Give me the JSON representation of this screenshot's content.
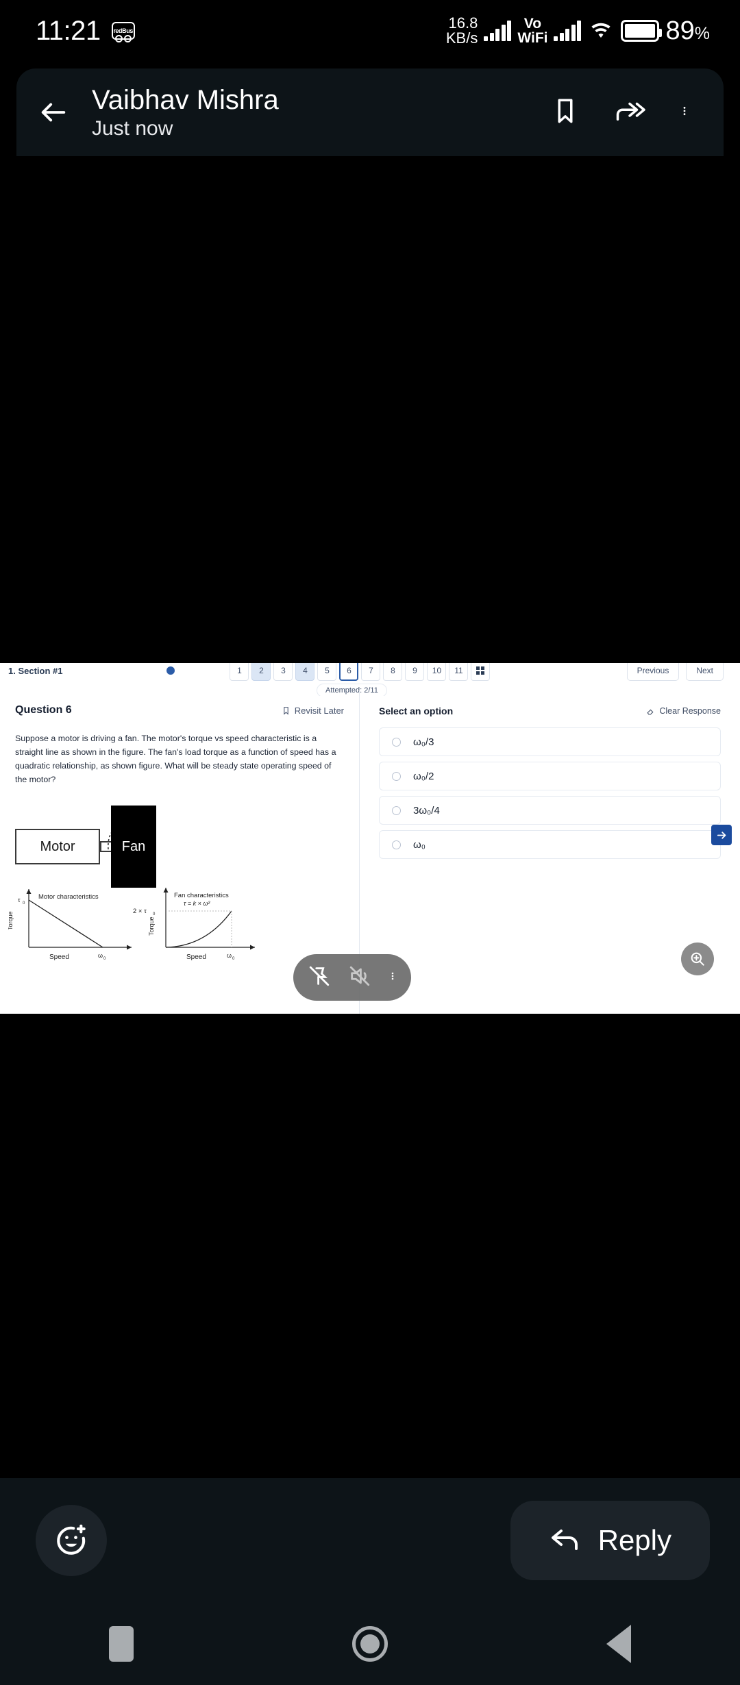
{
  "statusbar": {
    "time": "11:21",
    "app_icon": "redBus",
    "network_speed_value": "16.8",
    "network_speed_unit": "KB/s",
    "vo_label": "Vo",
    "wifi_label": "WiFi",
    "battery_percent": "89",
    "percent_sign": "%"
  },
  "header": {
    "title": "Vaibhav Mishra",
    "subtitle": "Just now",
    "back_icon": "arrow-left-icon",
    "bookmark_icon": "bookmark-icon",
    "forward_icon": "forward-double-arrow-icon",
    "overflow_icon": "more-vertical-icon"
  },
  "shared_screenshot": {
    "section_label": "1. Section #1",
    "question_chips": [
      "1",
      "2",
      "3",
      "4",
      "5",
      "6",
      "7",
      "8",
      "9",
      "10",
      "11"
    ],
    "current_chip": "6",
    "answered_chips": [
      "2",
      "4"
    ],
    "grid_icon": "grid-view-icon",
    "previous_label": "Previous",
    "next_label": "Next",
    "attempted_label": "Attempted: 2/11",
    "question_number": "Question 6",
    "revisit_label": "Revisit Later",
    "revisit_icon": "bookmark-outline-icon",
    "question_text": "Suppose a motor is driving a fan. The motor's torque vs speed characteristic is a straight line as shown in the figure. The fan's load torque as a function of speed has a quadratic relationship, as shown figure. What will be steady state operating speed of the motor?",
    "diagram": {
      "motor_label": "Motor",
      "fan_label": "Fan"
    },
    "options_title": "Select an option",
    "clear_response_label": "Clear Response",
    "clear_response_icon": "eraser-icon",
    "options": [
      {
        "id": "A",
        "text": "ω₀/3",
        "selected": false
      },
      {
        "id": "B",
        "text": "ω₀/2",
        "selected": false
      },
      {
        "id": "C",
        "text": "3ω₀/4",
        "selected": false
      },
      {
        "id": "D",
        "text": "ω₀",
        "selected": false
      }
    ],
    "next_arrow_icon": "arrow-right-icon",
    "magnify_icon": "zoom-in-icon",
    "accent_blue": "#1b4b9e"
  },
  "chart_data": [
    {
      "type": "line",
      "title": "Motor characteristics",
      "xlabel": "Speed",
      "ylabel": "Torque",
      "x": [
        0,
        1
      ],
      "y": [
        1,
        0
      ],
      "x_tick_labels": [
        "ω₀"
      ],
      "y_tick_labels": [
        "τ₀"
      ],
      "grid": false,
      "annotation": "Straight line: torque decreases linearly from τ₀ at zero speed to 0 at ω₀"
    },
    {
      "type": "line",
      "title": "Fan characteristics",
      "subtitle": "τ = k × ω²",
      "xlabel": "Speed",
      "ylabel": "Torque",
      "x": [
        0,
        0.25,
        0.5,
        0.75,
        1
      ],
      "y": [
        0,
        0.0625,
        0.25,
        0.5625,
        1
      ],
      "x_tick_labels": [
        "ω₀"
      ],
      "y_tick_labels": [
        "2 × τ₀"
      ],
      "grid": false,
      "annotation": "Quadratic curve reaching 2 × τ₀ at speed ω₀"
    }
  ],
  "media_pill": {
    "unpin_icon": "pin-off-icon",
    "mute_icon": "volume-off-icon",
    "more_icon": "more-vertical-icon"
  },
  "reply_bar": {
    "emoji_icon": "emoji-add-icon",
    "reply_label": "Reply",
    "reply_icon": "reply-arrow-icon"
  },
  "navbar": {
    "recents_icon": "recents-square-icon",
    "home_icon": "home-circle-icon",
    "back_icon": "back-triangle-icon"
  }
}
